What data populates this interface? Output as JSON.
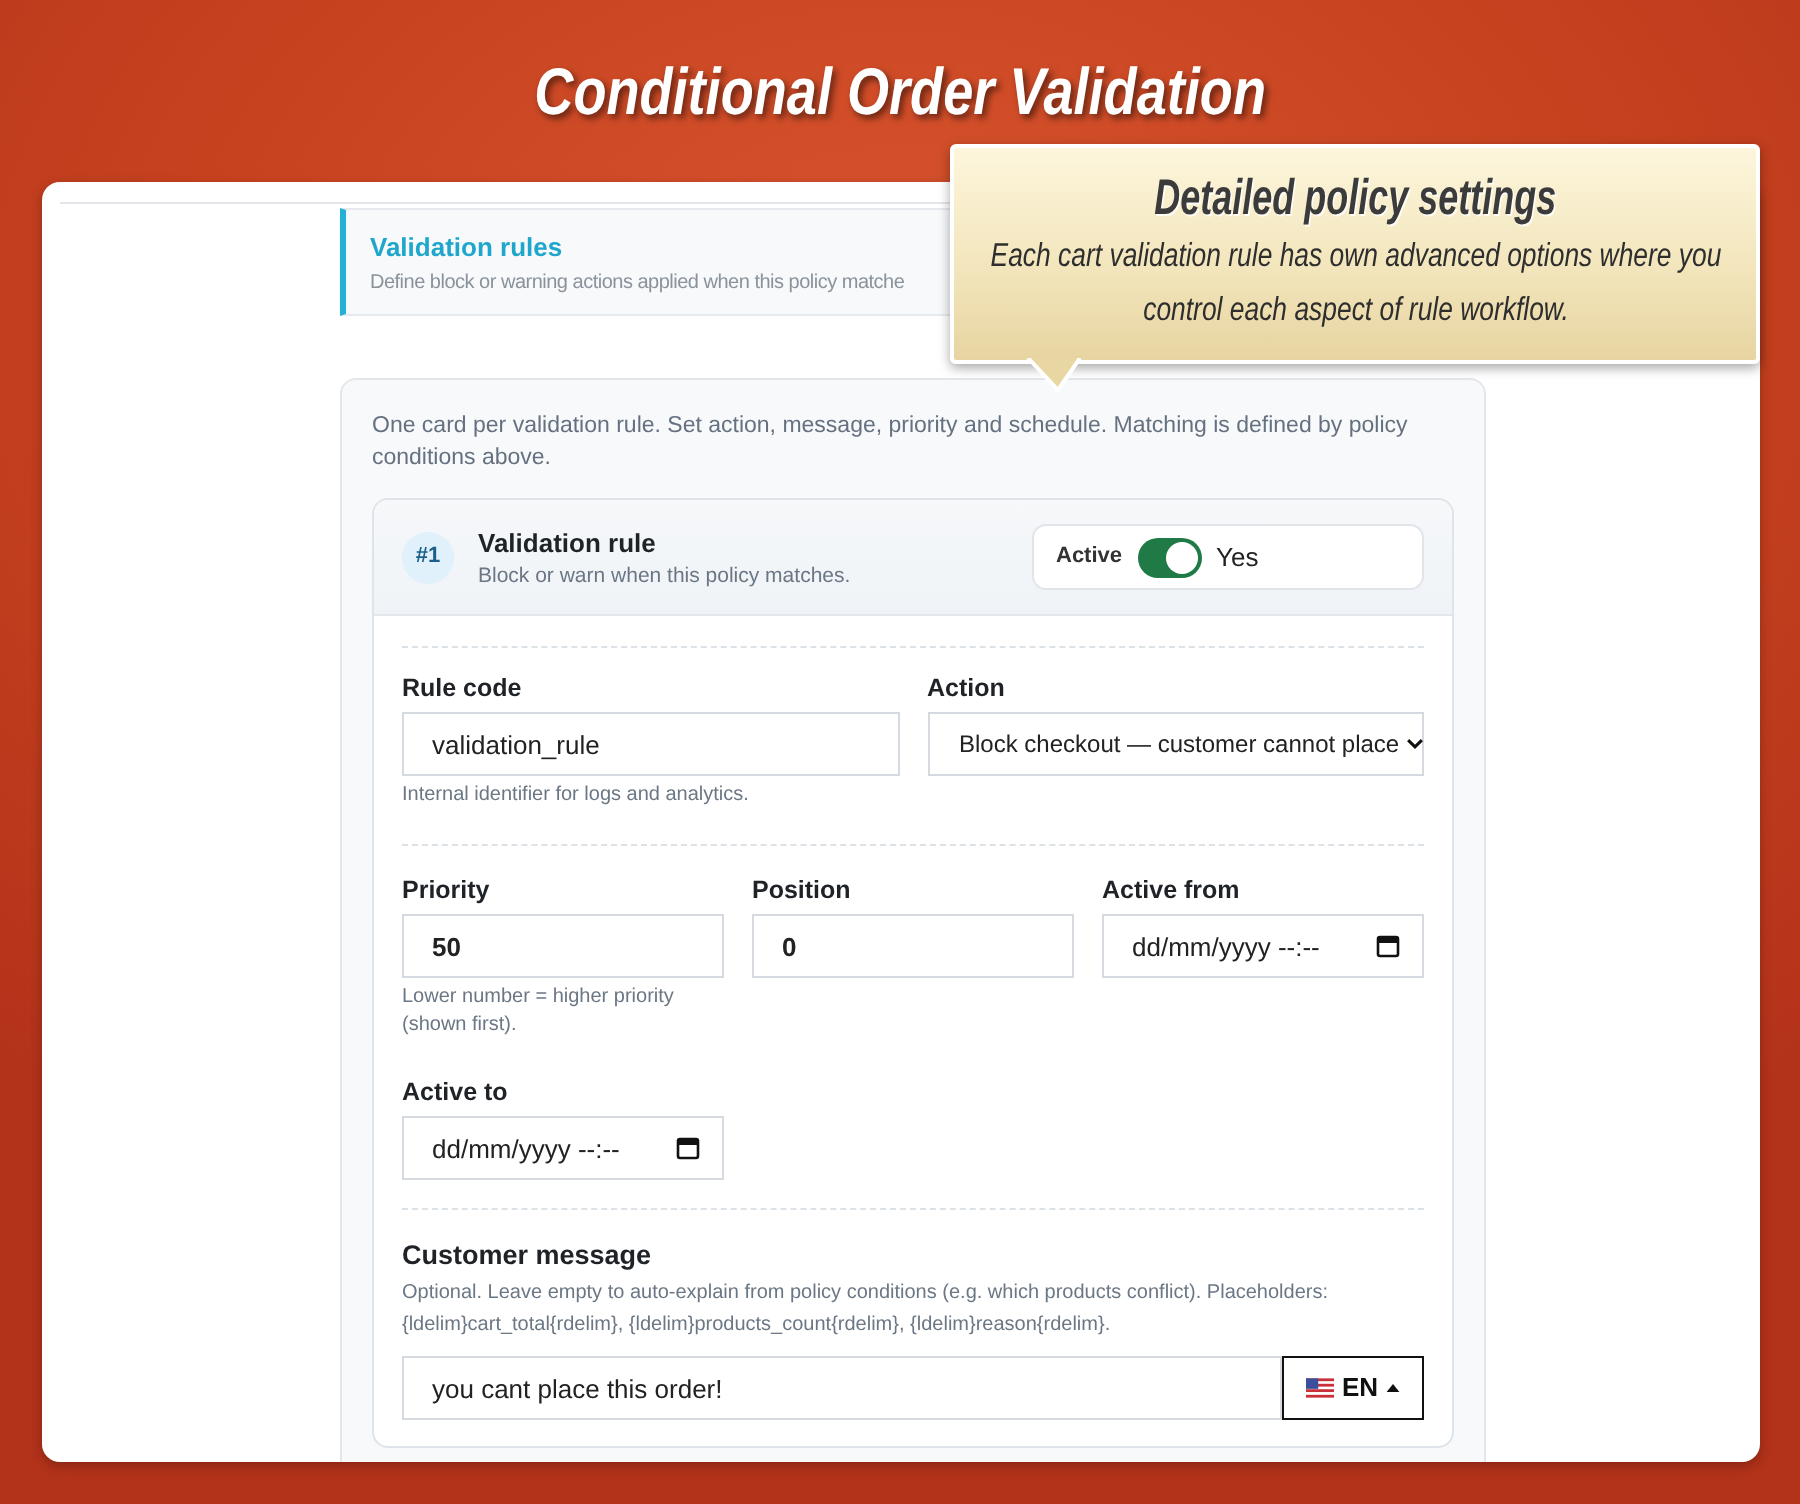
{
  "banner": {
    "title": "Conditional Order Validation"
  },
  "callout": {
    "title": "Detailed policy settings",
    "text": "Each cart validation rule has own advanced options where you control each aspect of rule workflow."
  },
  "section": {
    "title": "Validation rules",
    "description": "Define block or warning actions applied when this policy matche"
  },
  "rules_card": {
    "intro": "One card per validation rule. Set action, message, priority and schedule. Matching is defined by policy conditions above.",
    "rules": [
      {
        "badge": "#1",
        "title": "Validation rule",
        "subtitle": "Block or warn when this policy matches.",
        "active": {
          "label": "Active",
          "on": true,
          "value": "Yes"
        },
        "groups": [
          {
            "fields": [
              {
                "kind": "text",
                "label": "Rule code",
                "value": "validation_rule",
                "help": "Internal identifier for logs and analytics."
              },
              {
                "kind": "select",
                "label": "Action",
                "value": "Block checkout — customer cannot place"
              }
            ]
          },
          {
            "fields": [
              {
                "kind": "number",
                "label": "Priority",
                "value": "50",
                "help": "Lower number = higher priority (shown first)."
              },
              {
                "kind": "number",
                "label": "Position",
                "value": "0"
              },
              {
                "kind": "date",
                "label": "Active from",
                "placeholder": "dd/mm/yyyy --:--"
              },
              {
                "kind": "date",
                "label": "Active to",
                "placeholder": "dd/mm/yyyy --:--"
              }
            ]
          }
        ],
        "message": {
          "label": "Customer message",
          "help": "Optional. Leave empty to auto-explain from policy conditions (e.g. which products conflict). Placeholders: {ldelim}cart_total{rdelim}, {ldelim}products_count{rdelim}, {ldelim}reason{rdelim}.",
          "value": "you cant place this order!",
          "language": "EN"
        }
      }
    ]
  }
}
